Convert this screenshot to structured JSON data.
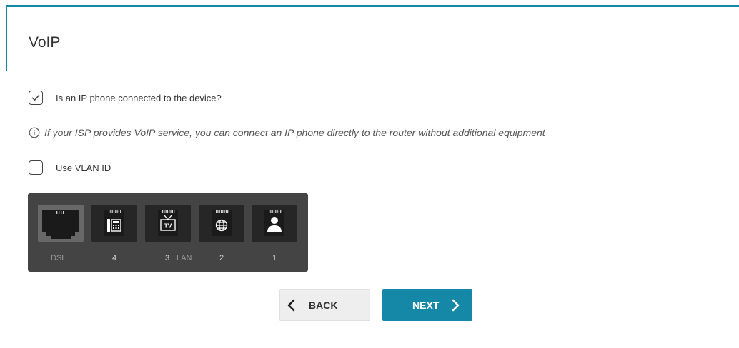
{
  "page": {
    "title": "VoIP"
  },
  "ip_phone": {
    "label": "Is an IP phone connected to the device?",
    "checked": true
  },
  "info": {
    "text": "If your ISP provides VoIP service, you can connect an IP phone directly to the router without additional equipment"
  },
  "vlan": {
    "label": "Use VLAN ID",
    "checked": false
  },
  "ports": {
    "dsl_label": "DSL",
    "lan_group_label": "LAN",
    "items": [
      {
        "id": "dsl",
        "icon": "dsl-port-icon"
      },
      {
        "id": "4",
        "label": "4",
        "icon": "phone-icon"
      },
      {
        "id": "3",
        "label": "3",
        "icon": "tv-icon"
      },
      {
        "id": "2",
        "label": "2",
        "icon": "globe-icon"
      },
      {
        "id": "1",
        "label": "1",
        "icon": "user-icon"
      }
    ]
  },
  "buttons": {
    "back": "BACK",
    "next": "NEXT"
  },
  "colors": {
    "accent": "#1588a8",
    "panel": "#444444",
    "port_active": "#262626",
    "port_dsl": "#686868"
  }
}
